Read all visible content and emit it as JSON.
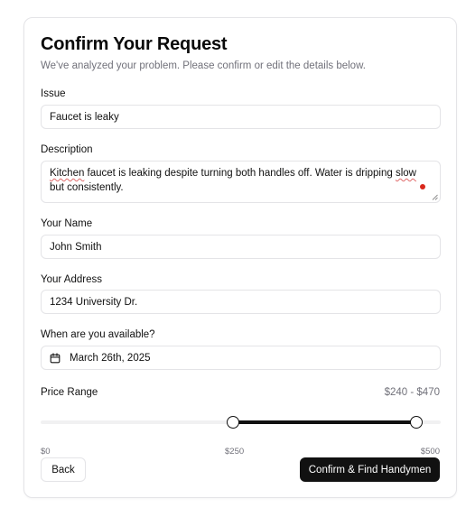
{
  "form": {
    "title": "Confirm Your Request",
    "subtitle": "We've analyzed your problem. Please confirm or edit the details below."
  },
  "issue": {
    "label": "Issue",
    "value": "Faucet is leaky"
  },
  "description": {
    "label": "Description",
    "word_kitchen": "Kitchen",
    "text_middle": " faucet is leaking despite turning both handles off. Water is dripping ",
    "word_slow": "slow",
    "text_end": " but consistently."
  },
  "name": {
    "label": "Your Name",
    "value": "John Smith"
  },
  "address": {
    "label": "Your Address",
    "value": "1234 University Dr."
  },
  "availability": {
    "label": "When are you available?",
    "value": "March 26th, 2025",
    "icon": "calendar-icon"
  },
  "price": {
    "label": "Price Range",
    "display": "$240 - $470",
    "min": 0,
    "max": 500,
    "low": 240,
    "high": 470,
    "tick_min": "$0",
    "tick_mid": "$250",
    "tick_max": "$500"
  },
  "actions": {
    "back_label": "Back",
    "confirm_label": "Confirm & Find Handymen"
  },
  "colors": {
    "primary": "#111111",
    "muted_text": "#71717a",
    "border": "#e4e4e7",
    "track": "#f1f1f2",
    "indicator_dot": "#d9281c"
  }
}
